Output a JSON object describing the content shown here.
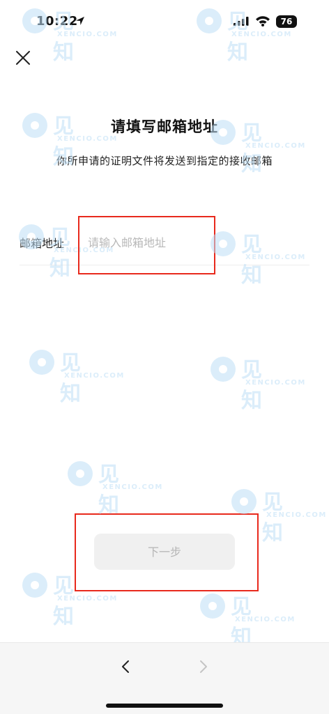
{
  "status_bar": {
    "time": "10:22",
    "battery": "76",
    "icons": [
      "location-arrow-icon",
      "signal-icon",
      "wifi-icon",
      "battery-icon"
    ]
  },
  "header": {
    "close_icon": "close-icon"
  },
  "content": {
    "title": "请填写邮箱地址",
    "subtitle": "你所申请的证明文件将发送到指定的接收邮箱"
  },
  "form": {
    "email_label": "邮箱地址",
    "email_placeholder": "请输入邮箱地址",
    "email_value": ""
  },
  "actions": {
    "next_label": "下一步"
  },
  "nav": {
    "back_icon": "chevron-left-icon",
    "forward_icon": "chevron-right-icon"
  },
  "watermark": {
    "text": "见知",
    "sub": "XENCIO.COM"
  },
  "colors": {
    "highlight": "#e8291c",
    "watermark": "#bfdff6",
    "button_bg": "#f0f0f0",
    "button_text": "#b5b5b5"
  }
}
